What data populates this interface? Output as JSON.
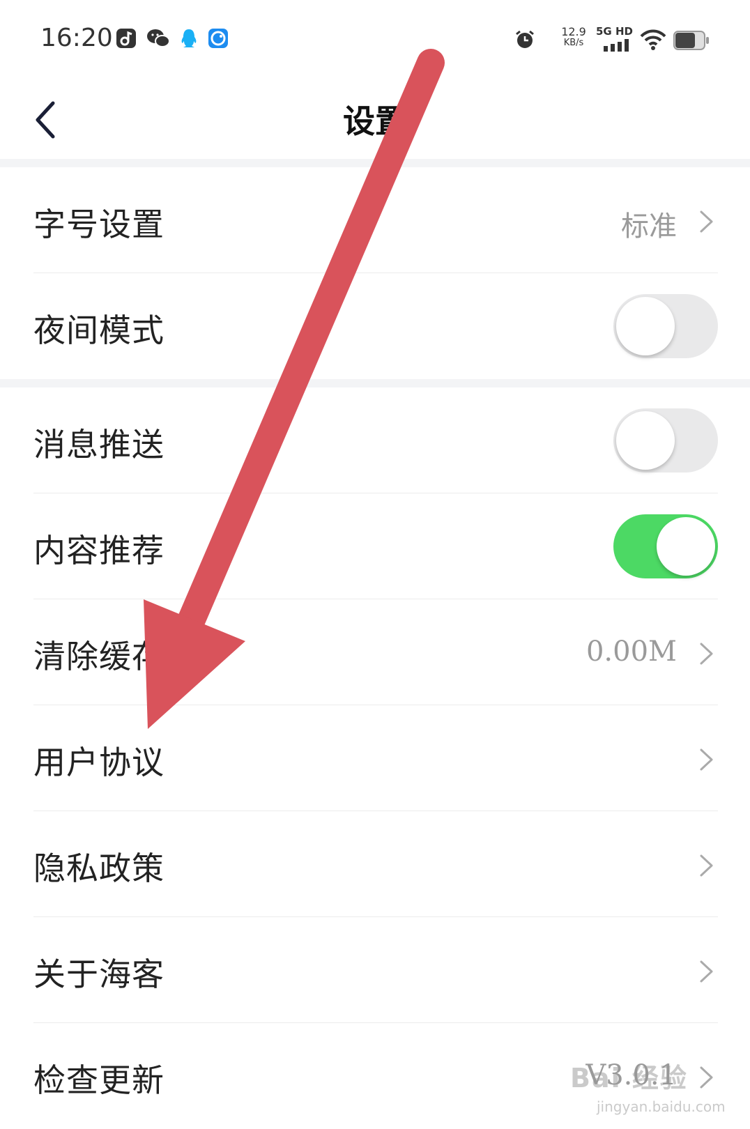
{
  "status_bar": {
    "time": "16:20",
    "net_speed": "12.9",
    "net_speed_unit": "KB/s",
    "network_type": "5G HD",
    "left_icons": [
      "music-app-icon",
      "wechat-icon",
      "qq-icon",
      "app-notification-icon"
    ],
    "right_icons": [
      "alarm-icon",
      "signal-bars-icon",
      "wifi-icon",
      "battery-icon"
    ]
  },
  "header": {
    "title": "设置",
    "back_icon": "chevron-left-icon"
  },
  "settings": {
    "font_size": {
      "label": "字号设置",
      "value": "标准"
    },
    "night_mode": {
      "label": "夜间模式",
      "enabled": false
    },
    "push_notifications": {
      "label": "消息推送",
      "enabled": false
    },
    "content_recommendation": {
      "label": "内容推荐",
      "enabled": true
    },
    "clear_cache": {
      "label": "清除缓存",
      "value": "0.00M"
    },
    "user_agreement": {
      "label": "用户协议"
    },
    "privacy_policy": {
      "label": "隐私政策"
    },
    "about": {
      "label": "关于海客"
    },
    "check_update": {
      "label": "检查更新",
      "value": "V3.0.1"
    }
  },
  "colors": {
    "toggle_on": "#4cd964",
    "toggle_off": "#e9e9ea",
    "annotation_arrow": "#d9535b",
    "value_text": "#9a9a9a"
  },
  "watermark": {
    "logo": "Bai 经验",
    "url": "jingyan.baidu.com"
  }
}
